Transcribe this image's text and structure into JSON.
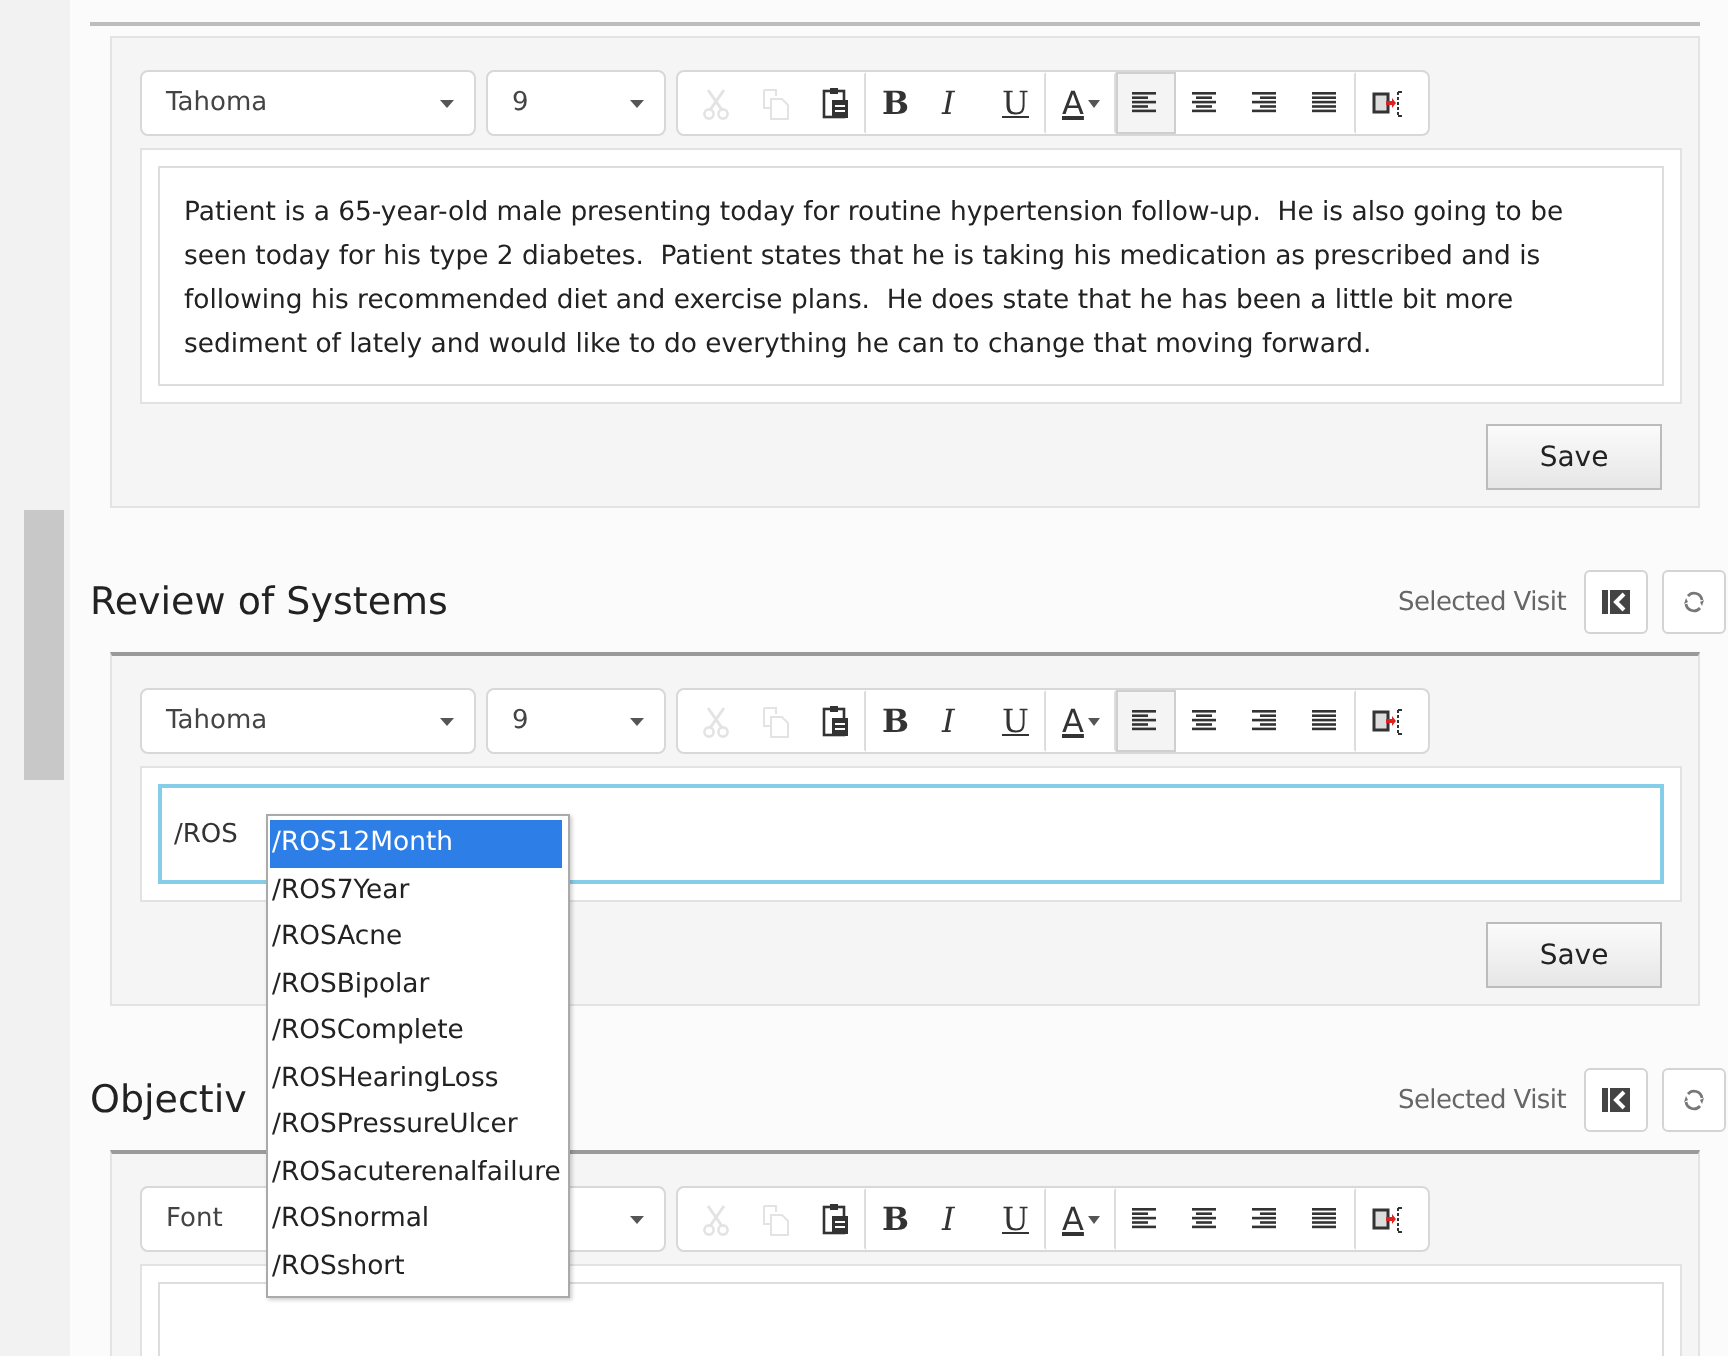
{
  "sections": [
    {
      "toolbar": {
        "font": "Tahoma",
        "size": "9",
        "tools": [
          {
            "kind": "cut",
            "disabled": true,
            "selected": false,
            "group_end": false
          },
          {
            "kind": "copy",
            "disabled": true,
            "selected": false,
            "group_end": false
          },
          {
            "kind": "paste",
            "disabled": false,
            "selected": false,
            "group_end": true
          },
          {
            "kind": "bold",
            "label": "B",
            "disabled": false,
            "selected": false,
            "group_end": false
          },
          {
            "kind": "italic",
            "label": "I",
            "disabled": false,
            "selected": false,
            "group_end": false
          },
          {
            "kind": "underline",
            "label": "U",
            "disabled": false,
            "selected": false,
            "group_end": true
          },
          {
            "kind": "color",
            "label": "A",
            "disabled": false,
            "selected": false,
            "group_end": true
          },
          {
            "kind": "align-left",
            "disabled": false,
            "selected": true,
            "group_end": false
          },
          {
            "kind": "align-center",
            "disabled": false,
            "selected": false,
            "group_end": false
          },
          {
            "kind": "align-right",
            "disabled": false,
            "selected": false,
            "group_end": false
          },
          {
            "kind": "justify",
            "disabled": false,
            "selected": false,
            "group_end": true
          },
          {
            "kind": "insert",
            "disabled": false,
            "selected": false,
            "group_end": false
          }
        ]
      },
      "editor": {
        "kind": "text",
        "text": "Patient is a 65-year-old male presenting today for routine hypertension follow-up.  He is also going to be seen today for his type 2 diabetes.  Patient states that he is taking his medication as prescribed and is following his recommended diet and exercise plans.  He does state that he has been a little bit more sediment of lately and would like to do everything he can to change that moving forward."
      },
      "save": "Save"
    },
    {
      "title": "Review of Systems",
      "visit_label": "Selected Visit",
      "toolbar": {
        "font": "Tahoma",
        "size": "9",
        "tools": [
          {
            "kind": "cut",
            "disabled": true,
            "selected": false,
            "group_end": false
          },
          {
            "kind": "copy",
            "disabled": true,
            "selected": false,
            "group_end": false
          },
          {
            "kind": "paste",
            "disabled": false,
            "selected": false,
            "group_end": true
          },
          {
            "kind": "bold",
            "label": "B",
            "disabled": false,
            "selected": false,
            "group_end": false
          },
          {
            "kind": "italic",
            "label": "I",
            "disabled": false,
            "selected": false,
            "group_end": false
          },
          {
            "kind": "underline",
            "label": "U",
            "disabled": false,
            "selected": false,
            "group_end": true
          },
          {
            "kind": "color",
            "label": "A",
            "disabled": false,
            "selected": false,
            "group_end": true
          },
          {
            "kind": "align-left",
            "disabled": false,
            "selected": true,
            "group_end": false
          },
          {
            "kind": "align-center",
            "disabled": false,
            "selected": false,
            "group_end": false
          },
          {
            "kind": "align-right",
            "disabled": false,
            "selected": false,
            "group_end": false
          },
          {
            "kind": "justify",
            "disabled": false,
            "selected": false,
            "group_end": true
          },
          {
            "kind": "insert",
            "disabled": false,
            "selected": false,
            "group_end": false
          }
        ]
      },
      "editor": {
        "kind": "input",
        "value": "/ROS",
        "suggestions": [
          {
            "label": "/ROS12Month",
            "selected": true
          },
          {
            "label": "/ROS7Year",
            "selected": false
          },
          {
            "label": "/ROSAcne",
            "selected": false
          },
          {
            "label": "/ROSBipolar",
            "selected": false
          },
          {
            "label": "/ROSComplete",
            "selected": false
          },
          {
            "label": "/ROSHearingLoss",
            "selected": false
          },
          {
            "label": "/ROSPressureUlcer",
            "selected": false
          },
          {
            "label": "/ROSacuterenalfailure",
            "selected": false
          },
          {
            "label": "/ROSnormal",
            "selected": false
          },
          {
            "label": "/ROSshort",
            "selected": false
          }
        ]
      },
      "save": "Save"
    },
    {
      "title": "Objectiv",
      "visit_label": "Selected Visit",
      "toolbar": {
        "font": "Font",
        "tools": [
          {
            "kind": "cut",
            "disabled": true,
            "selected": false,
            "group_end": false
          },
          {
            "kind": "copy",
            "disabled": true,
            "selected": false,
            "group_end": false
          },
          {
            "kind": "paste",
            "disabled": false,
            "selected": false,
            "group_end": true
          },
          {
            "kind": "bold",
            "label": "B",
            "disabled": false,
            "selected": false,
            "group_end": false
          },
          {
            "kind": "italic",
            "label": "I",
            "disabled": false,
            "selected": false,
            "group_end": false
          },
          {
            "kind": "underline",
            "label": "U",
            "disabled": false,
            "selected": false,
            "group_end": true
          },
          {
            "kind": "color",
            "label": "A",
            "disabled": false,
            "selected": false,
            "group_end": true
          },
          {
            "kind": "align-left",
            "disabled": false,
            "selected": false,
            "group_end": false
          },
          {
            "kind": "align-center",
            "disabled": false,
            "selected": false,
            "group_end": false
          },
          {
            "kind": "align-right",
            "disabled": false,
            "selected": false,
            "group_end": false
          },
          {
            "kind": "justify",
            "disabled": false,
            "selected": false,
            "group_end": true
          },
          {
            "kind": "insert",
            "disabled": false,
            "selected": false,
            "group_end": false
          }
        ]
      },
      "editor": {
        "kind": "text"
      }
    }
  ]
}
